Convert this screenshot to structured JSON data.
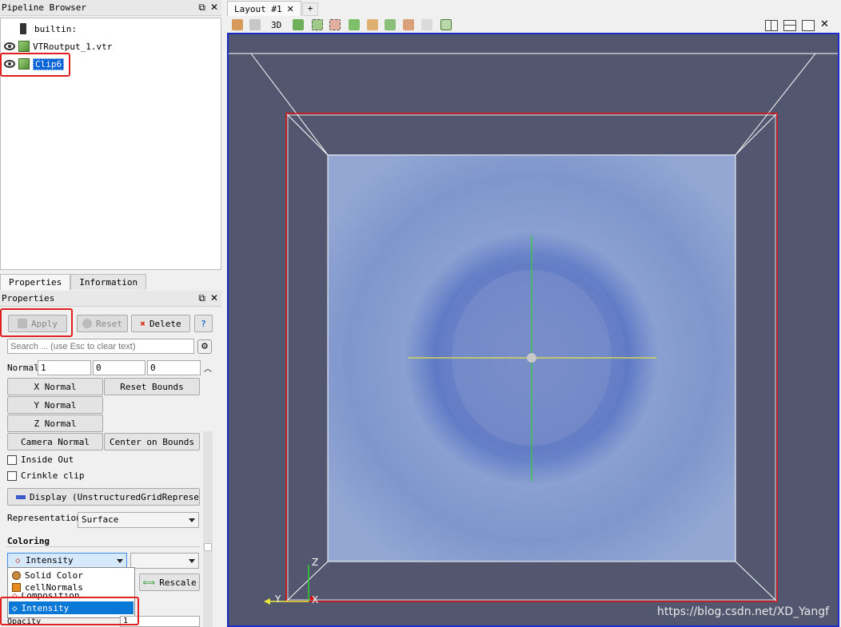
{
  "pipeline": {
    "title": "Pipeline Browser",
    "items": [
      {
        "label": "builtin:"
      },
      {
        "label": "VTRoutput_1.vtr"
      },
      {
        "label": "Clip6"
      }
    ]
  },
  "tabs": {
    "properties": "Properties",
    "information": "Information"
  },
  "properties": {
    "title": "Properties",
    "apply": "Apply",
    "reset": "Reset",
    "delete": "Delete",
    "help": "?",
    "search_placeholder": "Search ... (use Esc to clear text)",
    "normal_label": "Normal",
    "normal_values": [
      "1",
      "0",
      "0"
    ],
    "x_normal": "X Normal",
    "y_normal": "Y Normal",
    "z_normal": "Z Normal",
    "reset_bounds": "Reset Bounds",
    "camera_normal": "Camera Normal",
    "center_on_bounds": "Center on Bounds",
    "inside_out": "Inside Out",
    "crinkle_clip": "Crinkle clip",
    "display": "Display (UnstructuredGridRepresen",
    "representation_label": "Representation",
    "representation_value": "Surface",
    "coloring_label": "Coloring",
    "coloring_value": "Intensity",
    "rescale": "Rescale",
    "dropdown_options": [
      "Solid Color",
      "cellNormals",
      "Composition",
      "Intensity"
    ],
    "opacity_label": "Opacity",
    "opacity_value": "1"
  },
  "layout": {
    "tab_label": "Layout #1",
    "add_tab": "+",
    "mode_3d": "3D"
  },
  "axes": {
    "z": "Z",
    "y": "Y",
    "x": "X"
  },
  "watermark": "https://blog.csdn.net/XD_Yangf",
  "colors": {
    "viewport_bg": "#52566e",
    "highlight": "#e02020",
    "selection": "#3399ff"
  }
}
